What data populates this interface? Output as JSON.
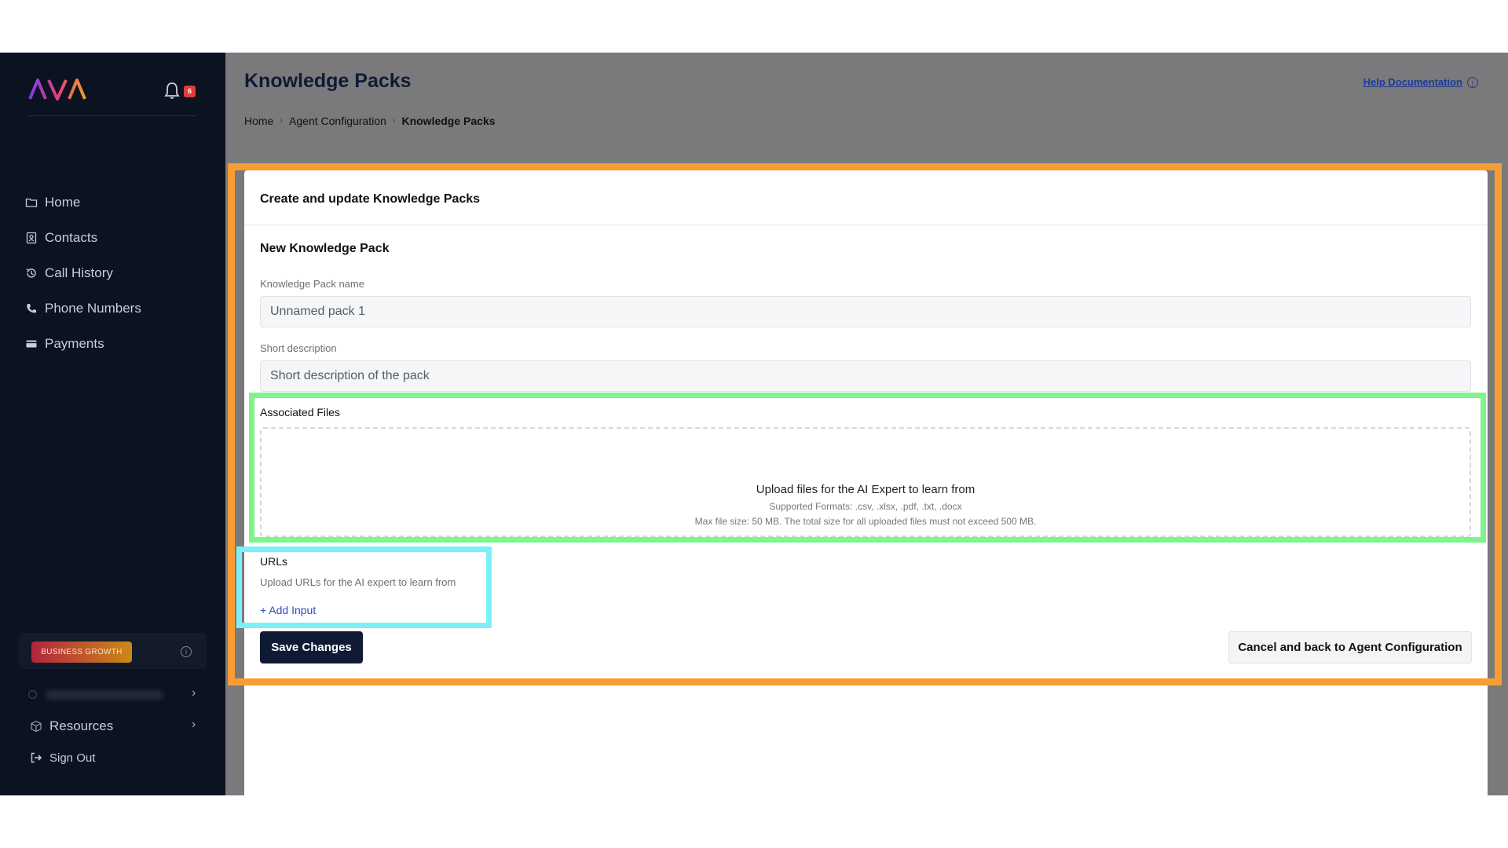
{
  "app": {
    "logo_text": "AVA",
    "notification_count": "6"
  },
  "sidebar": {
    "items": [
      {
        "label": "Home",
        "icon": "folder-icon"
      },
      {
        "label": "Contacts",
        "icon": "contacts-icon"
      },
      {
        "label": "Call History",
        "icon": "history-icon"
      },
      {
        "label": "Phone Numbers",
        "icon": "phone-icon"
      },
      {
        "label": "Payments",
        "icon": "card-icon"
      }
    ],
    "plan_badge": "BUSINESS GROWTH",
    "resources_label": "Resources",
    "signout_label": "Sign Out"
  },
  "header": {
    "title": "Knowledge Packs",
    "help_label": "Help Documentation",
    "breadcrumb": [
      "Home",
      "Agent Configuration",
      "Knowledge Packs"
    ]
  },
  "card": {
    "title": "Create and update Knowledge Packs",
    "form_title": "New Knowledge Pack",
    "name_label": "Knowledge Pack name",
    "name_value": "Unnamed pack 1",
    "desc_label": "Short description",
    "desc_placeholder": "Short description of the pack",
    "files_label": "Associated Files",
    "drop_title": "Upload files for the AI Expert to learn from",
    "drop_formats": "Supported Formats: .csv, .xlsx, .pdf, .txt, .docx",
    "drop_max": "Max file size: 50 MB. The total size for all uploaded files must not exceed 500 MB.",
    "urls_label": "URLs",
    "urls_help": "Upload URLs for the AI expert to learn from",
    "add_input": "+ Add Input",
    "save_label": "Save Changes",
    "cancel_label": "Cancel and back to Agent Configuration"
  },
  "highlights": {
    "orange": "#f79d33",
    "green": "#7ff48a",
    "cyan": "#7bf0f8"
  }
}
